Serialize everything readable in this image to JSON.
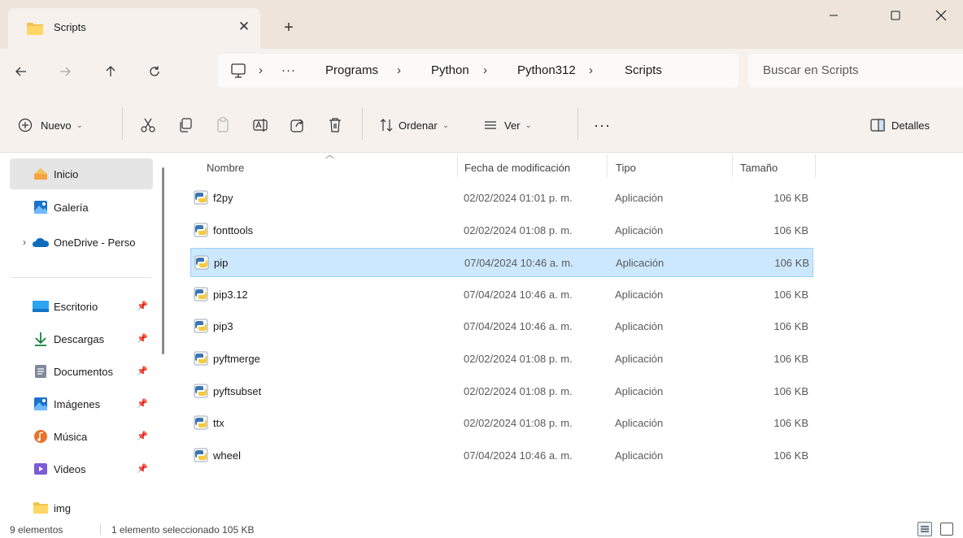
{
  "window": {
    "tab_title": "Scripts",
    "new_tab_label": "+"
  },
  "nav": {
    "breadcrumb": [
      "···",
      "Programs",
      "Python",
      "Python312",
      "Scripts"
    ],
    "search_placeholder": "Buscar en Scripts"
  },
  "toolbar": {
    "new_label": "Nuevo",
    "sort_label": "Ordenar",
    "view_label": "Ver",
    "more_label": "···",
    "details_label": "Detalles"
  },
  "sidebar": {
    "items": [
      {
        "label": "Inicio",
        "icon": "home-icon",
        "active": true
      },
      {
        "label": "Galería",
        "icon": "gallery-icon"
      },
      {
        "label": "OneDrive - Perso",
        "icon": "onedrive-icon"
      },
      {
        "label": "Escritorio",
        "icon": "desktop-icon",
        "pinned": true
      },
      {
        "label": "Descargas",
        "icon": "download-icon",
        "pinned": true
      },
      {
        "label": "Documentos",
        "icon": "documents-icon",
        "pinned": true
      },
      {
        "label": "Imágenes",
        "icon": "pictures-icon",
        "pinned": true
      },
      {
        "label": "Música",
        "icon": "music-icon",
        "pinned": true
      },
      {
        "label": "Videos",
        "icon": "videos-icon",
        "pinned": true
      },
      {
        "label": "img",
        "icon": "folder-icon"
      }
    ]
  },
  "files": {
    "columns": [
      "Nombre",
      "Fecha de modificación",
      "Tipo",
      "Tamaño"
    ],
    "rows": [
      {
        "name": "f2py",
        "date": "02/02/2024 01:01 p. m.",
        "type": "Aplicación",
        "size": "106 KB"
      },
      {
        "name": "fonttools",
        "date": "02/02/2024 01:08 p. m.",
        "type": "Aplicación",
        "size": "106 KB"
      },
      {
        "name": "pip",
        "date": "07/04/2024 10:46 a. m.",
        "type": "Aplicación",
        "size": "106 KB",
        "selected": true
      },
      {
        "name": "pip3.12",
        "date": "07/04/2024 10:46 a. m.",
        "type": "Aplicación",
        "size": "106 KB"
      },
      {
        "name": "pip3",
        "date": "07/04/2024 10:46 a. m.",
        "type": "Aplicación",
        "size": "106 KB"
      },
      {
        "name": "pyftmerge",
        "date": "02/02/2024 01:08 p. m.",
        "type": "Aplicación",
        "size": "106 KB"
      },
      {
        "name": "pyftsubset",
        "date": "02/02/2024 01:08 p. m.",
        "type": "Aplicación",
        "size": "106 KB"
      },
      {
        "name": "ttx",
        "date": "02/02/2024 01:08 p. m.",
        "type": "Aplicación",
        "size": "106 KB"
      },
      {
        "name": "wheel",
        "date": "07/04/2024 10:46 a. m.",
        "type": "Aplicación",
        "size": "106 KB"
      }
    ]
  },
  "status": {
    "count": "9 elementos",
    "selection": "1 elemento seleccionado  105 KB"
  },
  "colors": {
    "selected_row_bg": "#cce8ff",
    "selected_row_border": "#99d1ff",
    "titlebar_bg": "#eee4dc",
    "toolbar_bg": "#f6f1ed"
  }
}
